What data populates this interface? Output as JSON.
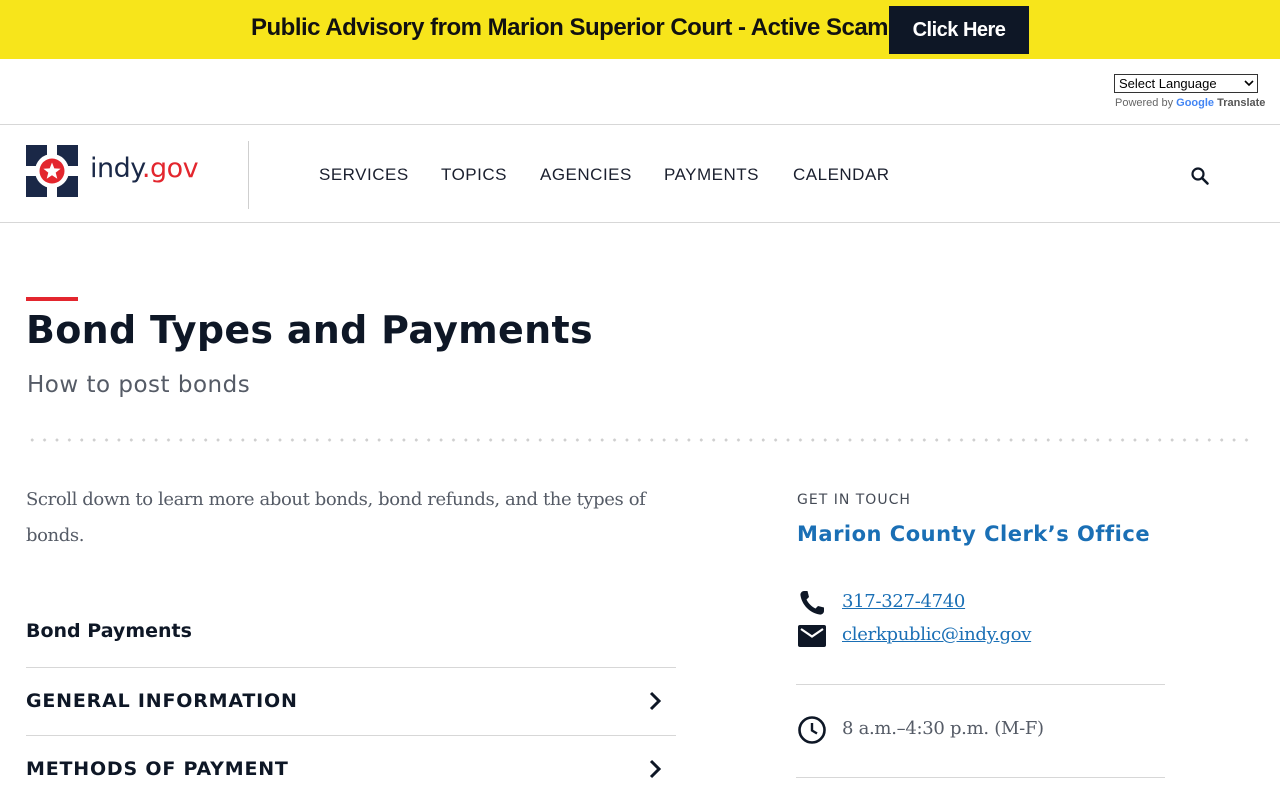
{
  "advisory": {
    "text": "Public Advisory from Marion Superior Court - Active Scams",
    "button_label": "Click Here"
  },
  "translate": {
    "select_value": "Select Language",
    "powered_by": "Powered by",
    "google": "Google",
    "translate_word": "Translate"
  },
  "header": {
    "logo_name": "indy",
    "logo_dot": ".",
    "logo_tld": "gov",
    "nav": [
      {
        "label": "SERVICES"
      },
      {
        "label": "TOPICS"
      },
      {
        "label": "AGENCIES"
      },
      {
        "label": "PAYMENTS"
      },
      {
        "label": "CALENDAR"
      }
    ],
    "search_icon": "search-icon"
  },
  "page": {
    "title": "Bond Types and Payments",
    "subtitle": "How to post bonds",
    "intro": "Scroll down to learn more about bonds, bond refunds, and the types of bonds.",
    "section_heading": "Bond Payments",
    "accordion": [
      {
        "label": "GENERAL INFORMATION"
      },
      {
        "label": "METHODS OF PAYMENT"
      }
    ]
  },
  "sidebar": {
    "eyebrow": "GET IN TOUCH",
    "org": "Marion County Clerk’s Office",
    "phone": "317-327-4740",
    "email": "clerkpublic@indy.gov",
    "hours": "8 a.m.–4:30 p.m. (M-F)"
  },
  "colors": {
    "advisory_bg": "#f7e51b",
    "accent_red": "#e3262e",
    "link_blue": "#1a6fb5",
    "navy": "#0e1726"
  }
}
